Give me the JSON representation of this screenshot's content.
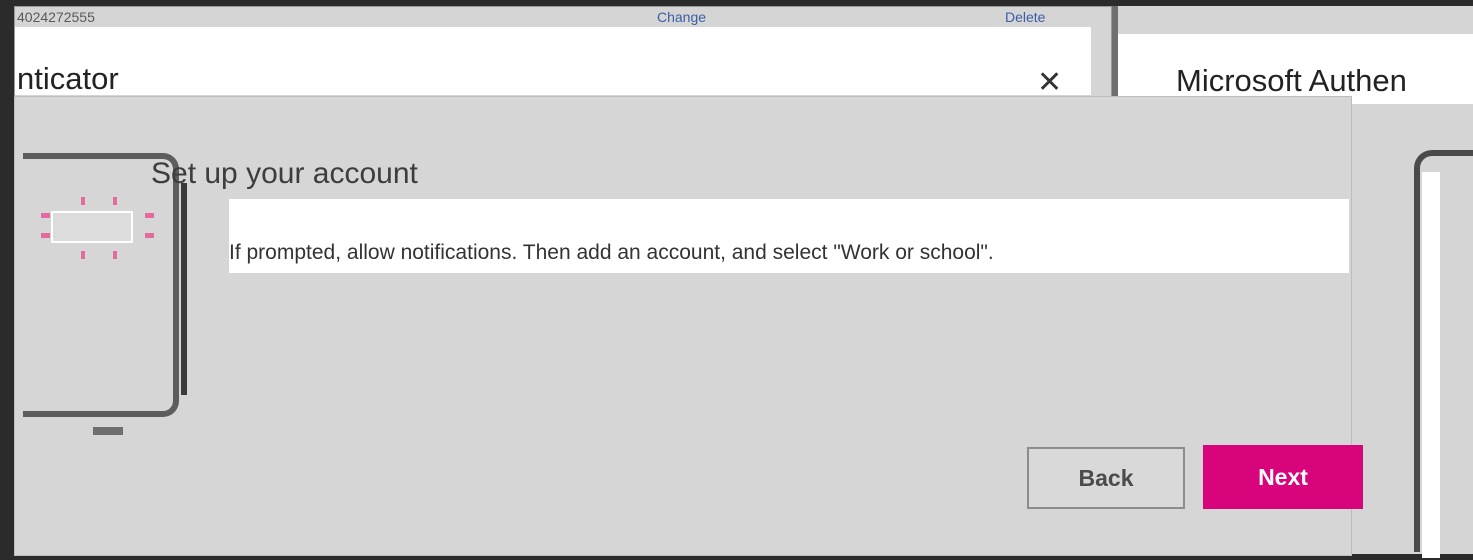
{
  "background_left": {
    "id_text": "4024272555",
    "change_link": "Change",
    "delete_link": "Delete",
    "title": "nticator"
  },
  "background_right": {
    "title": "Microsoft Authen"
  },
  "dialog": {
    "heading": "Set up your account",
    "instruction": "If prompted, allow notifications. Then add an account, and select \"Work or school\".",
    "back_label": "Back",
    "next_label": "Next"
  },
  "colors": {
    "accent": "#d7047c",
    "dialog_bg": "#d6d6d6",
    "page_bg": "#2b2b2b"
  },
  "icons": [
    "close-icon",
    "phone-illustration-icon"
  ]
}
